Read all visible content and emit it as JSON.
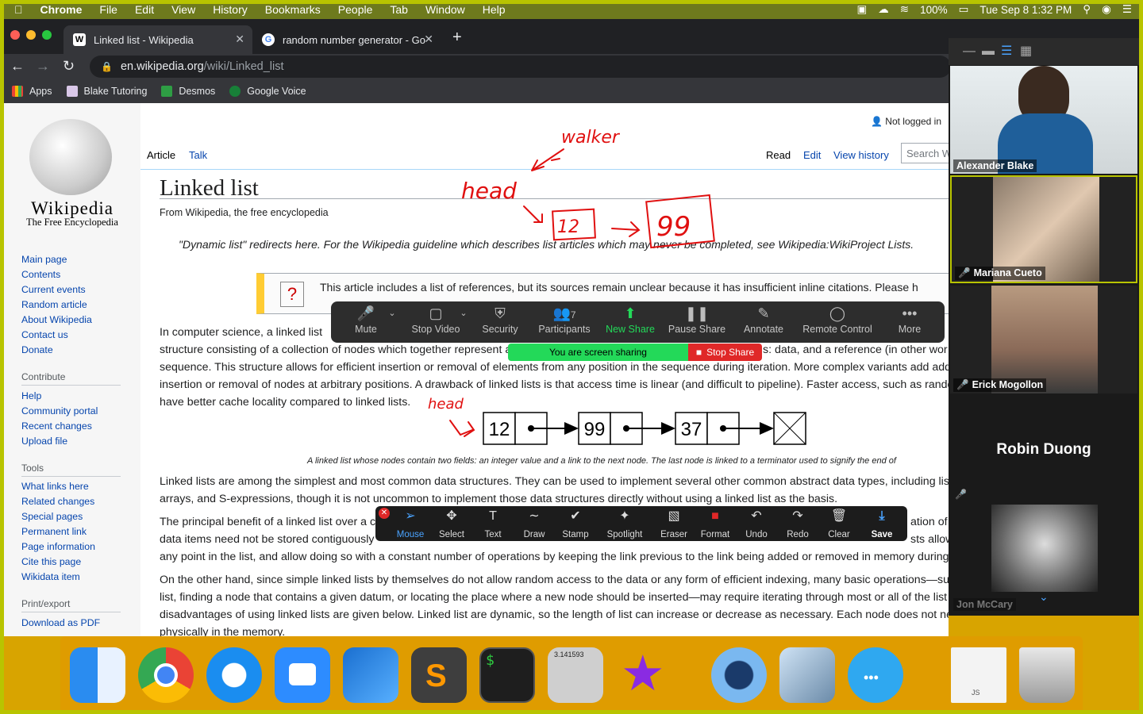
{
  "menubar": {
    "app": "Chrome",
    "items": [
      "File",
      "Edit",
      "View",
      "History",
      "Bookmarks",
      "People",
      "Tab",
      "Window",
      "Help"
    ],
    "battery": "100%",
    "datetime": "Tue Sep 8  1:32 PM"
  },
  "browser": {
    "tabs": [
      {
        "title": "Linked list - Wikipedia",
        "favicon": "W"
      },
      {
        "title": "random number generator - Go",
        "favicon": "G"
      }
    ],
    "url_host": "en.wikipedia.org",
    "url_path": "/wiki/Linked_list",
    "bookmarks": [
      "Apps",
      "Blake Tutoring",
      "Desmos",
      "Google Voice"
    ]
  },
  "wiki": {
    "logo_title": "Wikipedia",
    "logo_sub": "The Free Encyclopedia",
    "nav": [
      "Main page",
      "Contents",
      "Current events",
      "Random article",
      "About Wikipedia",
      "Contact us",
      "Donate"
    ],
    "contribute_head": "Contribute",
    "contribute": [
      "Help",
      "Community portal",
      "Recent changes",
      "Upload file"
    ],
    "tools_head": "Tools",
    "tools": [
      "What links here",
      "Related changes",
      "Special pages",
      "Permanent link",
      "Page information",
      "Cite this page",
      "Wikidata item"
    ],
    "print_head": "Print/export",
    "print": [
      "Download as PDF"
    ],
    "login": "Not logged in",
    "tab_article": "Article",
    "tab_talk": "Talk",
    "tab_read": "Read",
    "tab_edit": "Edit",
    "tab_history": "View history",
    "search_placeholder": "Search W",
    "title": "Linked list",
    "from": "From Wikipedia, the free encyclopedia",
    "hatnote": "\"Dynamic list\" redirects here. For the Wikipedia guideline which describes list articles which may never be completed, see Wikipedia:WikiProject Lists.",
    "ambox": "This article includes a list of references, but its sources remain unclear because it has insufficient inline citations. Please h",
    "p1_l1": "In computer science, a linked list",
    "p1_l2": "structure consisting of a collection of nodes which together represent a",
    "p1_l2b": "s: data, and a reference (in other wor",
    "p1_l3": "sequence. This structure allows for efficient insertion or removal of elements from any position in the sequence during iteration. More complex variants add additi",
    "p1_l4": "insertion or removal of nodes at arbitrary positions. A drawback of linked lists is that access time is linear (and difficult to pipeline). Faster access, such as randon",
    "p1_l5": "have better cache locality compared to linked lists.",
    "diagram_nodes": [
      "12",
      "99",
      "37"
    ],
    "caption": "A linked list whose nodes contain two fields: an integer value and a link to the next node. The last node is linked to a terminator used to signify the end of",
    "p2_l1": "Linked lists are among the simplest and most common data structures. They can be used to implement several other common abstract data types, including lists",
    "p2_l2": "arrays, and S-expressions, though it is not uncommon to implement those data structures directly without using a linked list as the basis.",
    "p3_l1a": "The principal benefit of a linked list over a co",
    "p3_l1b": "ation of th",
    "p3_l2a": "data items need not be stored contiguously",
    "p3_l2b": "sts allow",
    "p3_l3": "any point in the list, and allow doing so with a constant number of operations by keeping the link previous to the link being added or removed in memory during lis",
    "p4_l1": "On the other hand, since simple linked lists by themselves do not allow random access to the data or any form of efficient indexing, many basic operations—such",
    "p4_l2": "list, finding a node that contains a given datum, or locating the place where a new node should be inserted—may require iterating through most or all of the list el",
    "p4_l3": "disadvantages of using linked lists are given below. Linked list are dynamic, so the length of list can increase or decrease as necessary. Each node does not necessarily follow the previous one",
    "p4_l4": "physically in the memory."
  },
  "annotations_handwritten": {
    "walker": "walker",
    "head1": "head",
    "box1": "12",
    "box2": "99",
    "head2": "head"
  },
  "zoom": {
    "controls": [
      "Mute",
      "Stop Video",
      "Security",
      "Participants",
      "New Share",
      "Pause Share",
      "Annotate",
      "Remote Control",
      "More"
    ],
    "participants_count": "7",
    "sharing_text": "You are screen sharing",
    "stop_share": "Stop Share",
    "annotate_tools": [
      "Mouse",
      "Select",
      "Text",
      "Draw",
      "Stamp",
      "Spotlight",
      "Eraser",
      "Format",
      "Undo",
      "Redo",
      "Clear",
      "Save"
    ],
    "participants": [
      {
        "name": "Alexander Blake"
      },
      {
        "name": "Mariana Cueto"
      },
      {
        "name": "Erick Mogollon"
      },
      {
        "name": "Robin Duong"
      },
      {
        "name": "Jon McCary"
      }
    ]
  },
  "dock": {
    "apps": [
      "finder-icon",
      "chrome-icon",
      "safari-icon",
      "zoom-icon",
      "xcode-icon",
      "sublime-icon",
      "terminal-icon",
      "calculator-icon",
      "imovie-icon",
      "quicktime-icon",
      "preview-icon",
      "messages-icon",
      "js-file-icon",
      "trash-icon"
    ],
    "calc_display": "3.141593",
    "js_label": "JS"
  },
  "colors": {
    "link": "#0645ad",
    "accent_green": "#23d959",
    "stop_red": "#e02828",
    "ink_red": "#e01010"
  }
}
